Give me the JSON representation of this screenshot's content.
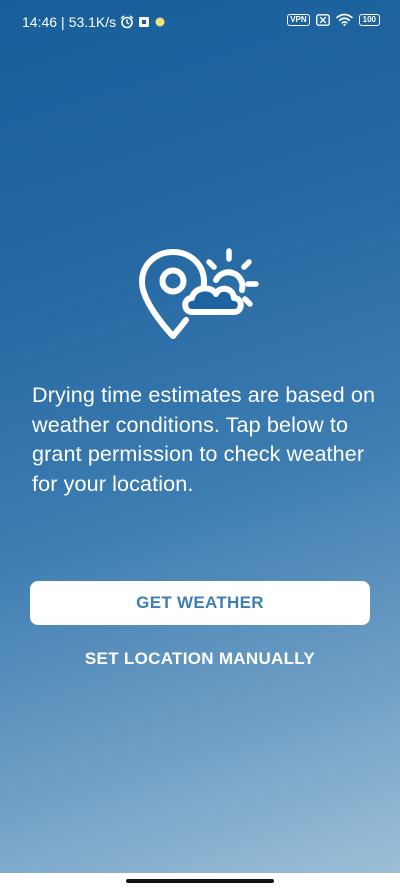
{
  "status_bar": {
    "time": "14:46",
    "separator": "|",
    "speed": "53.1K/s",
    "vpn": "VPN",
    "battery": "100",
    "icons": [
      "alarm-icon",
      "notification-icon",
      "dot-icon",
      "vpn-icon",
      "sim-icon",
      "wifi-icon",
      "battery-icon"
    ]
  },
  "hero": {
    "icon": "location-weather-icon"
  },
  "main": {
    "message": "Drying time estimates are based on weather conditions. Tap below to grant permission to check weather for your location.",
    "primary_button": "GET WEATHER",
    "secondary_button": "SET LOCATION MANUALLY"
  },
  "colors": {
    "background_top": "#175f9b",
    "background_bottom": "#9dbfd7",
    "button_background": "#ffffff",
    "button_text": "#3d7fb0",
    "text": "#ffffff"
  }
}
